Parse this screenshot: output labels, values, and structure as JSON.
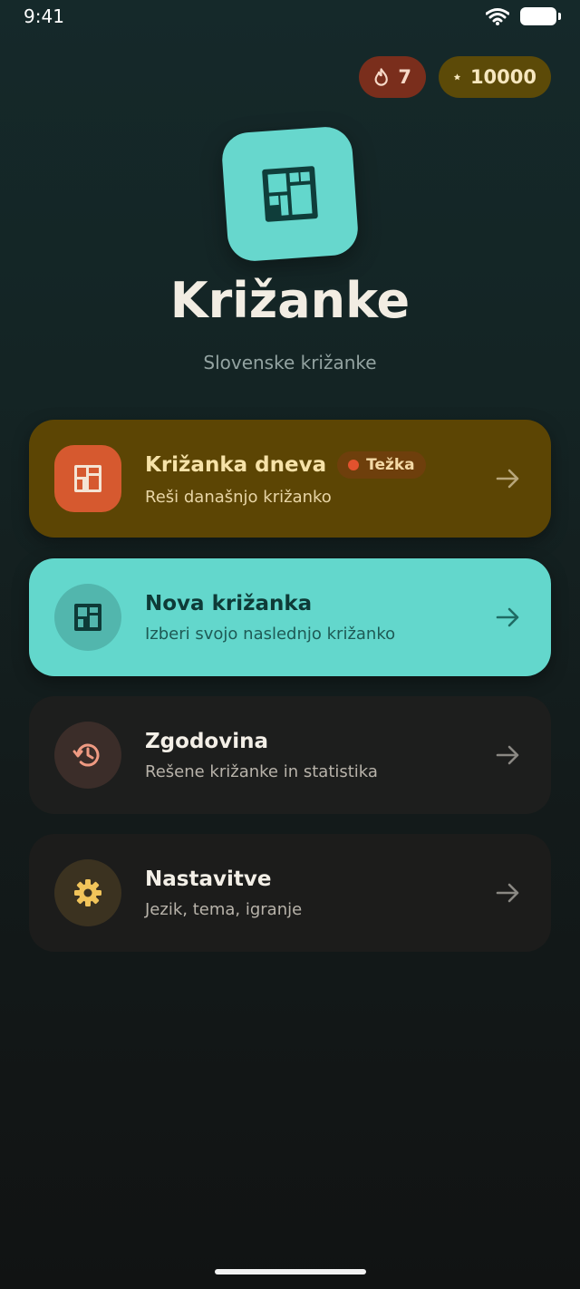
{
  "status_bar": {
    "time": "9:41"
  },
  "badges": {
    "streak": "7",
    "stars": "10000"
  },
  "app": {
    "title": "Križanke",
    "subtitle": "Slovenske križanke"
  },
  "menu": [
    {
      "title": "Križanka dneva",
      "description": "Reši današnjo križanko",
      "badge": "Težka"
    },
    {
      "title": "Nova križanka",
      "description": "Izberi svojo naslednjo križanko"
    },
    {
      "title": "Zgodovina",
      "description": "Rešene križanke in statistika"
    },
    {
      "title": "Nastavitve",
      "description": "Jezik, tema, igranje"
    }
  ],
  "icons": {
    "logo": "crossword-grid-icon",
    "streak": "flame-icon",
    "stars": "star-icon",
    "daily": "crossword-grid-icon",
    "new": "crossword-grid-icon",
    "history": "history-icon",
    "settings": "gear-icon",
    "arrow": "arrow-right-icon"
  },
  "colors": {
    "accent_teal": "#63d7cc",
    "daily_card": "#5c4504",
    "difficulty_hard": "#e2522e",
    "streak_badge": "#7a2e1c",
    "stars_badge": "#5c4a08"
  }
}
